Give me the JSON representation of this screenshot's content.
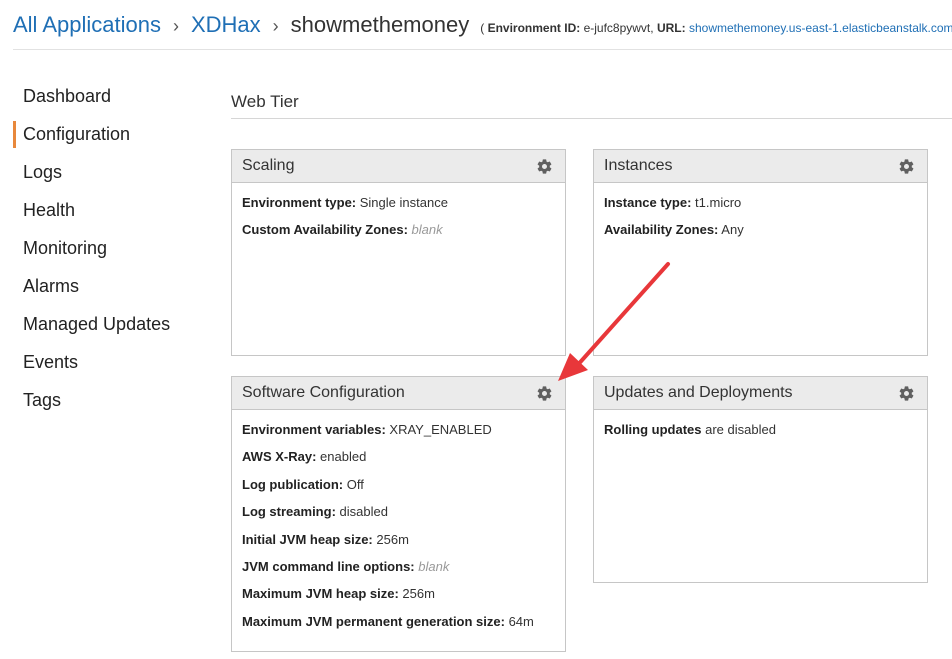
{
  "breadcrumb": {
    "root": "All Applications",
    "app": "XDHax",
    "current": "showmethemoney",
    "env_open": "( ",
    "env_id_label": "Environment ID:",
    "env_id": "e-jufc8pywvt,",
    "url_label": "URL:",
    "url": "showmethemoney.us-east-1.elasticbeanstalk.com"
  },
  "sidebar": {
    "items": [
      {
        "label": "Dashboard"
      },
      {
        "label": "Configuration",
        "active": true
      },
      {
        "label": "Logs"
      },
      {
        "label": "Health"
      },
      {
        "label": "Monitoring"
      },
      {
        "label": "Alarms"
      },
      {
        "label": "Managed Updates"
      },
      {
        "label": "Events"
      },
      {
        "label": "Tags"
      }
    ]
  },
  "section": {
    "title": "Web Tier"
  },
  "panels": {
    "scaling": {
      "title": "Scaling",
      "rows": [
        {
          "label": "Environment type:",
          "value": "Single instance"
        },
        {
          "label": "Custom Availability Zones:",
          "value": "blank"
        }
      ]
    },
    "instances": {
      "title": "Instances",
      "rows": [
        {
          "label": "Instance type:",
          "value": "t1.micro"
        },
        {
          "label": "Availability Zones:",
          "value": "Any"
        }
      ]
    },
    "software": {
      "title": "Software Configuration",
      "rows": [
        {
          "label": "Environment variables:",
          "value": "XRAY_ENABLED"
        },
        {
          "label": "AWS X-Ray:",
          "value": "enabled"
        },
        {
          "label": "Log publication:",
          "value": "Off"
        },
        {
          "label": "Log streaming:",
          "value": "disabled"
        },
        {
          "label": "Initial JVM heap size:",
          "value": "256m"
        },
        {
          "label": "JVM command line options:",
          "value": "blank"
        },
        {
          "label": "Maximum JVM heap size:",
          "value": "256m"
        },
        {
          "label": "Maximum JVM permanent generation size:",
          "value": "64m"
        }
      ]
    },
    "updates": {
      "title": "Updates and Deployments",
      "rows": [
        {
          "label": "Rolling updates",
          "value": "are disabled"
        }
      ]
    }
  },
  "colors": {
    "link": "#1f6fb5",
    "active_marker": "#e8883c",
    "annotation_arrow": "#e8373a"
  },
  "icons": {
    "settings": "gear-icon",
    "breadcrumb_separator": "chevron-right-icon"
  }
}
